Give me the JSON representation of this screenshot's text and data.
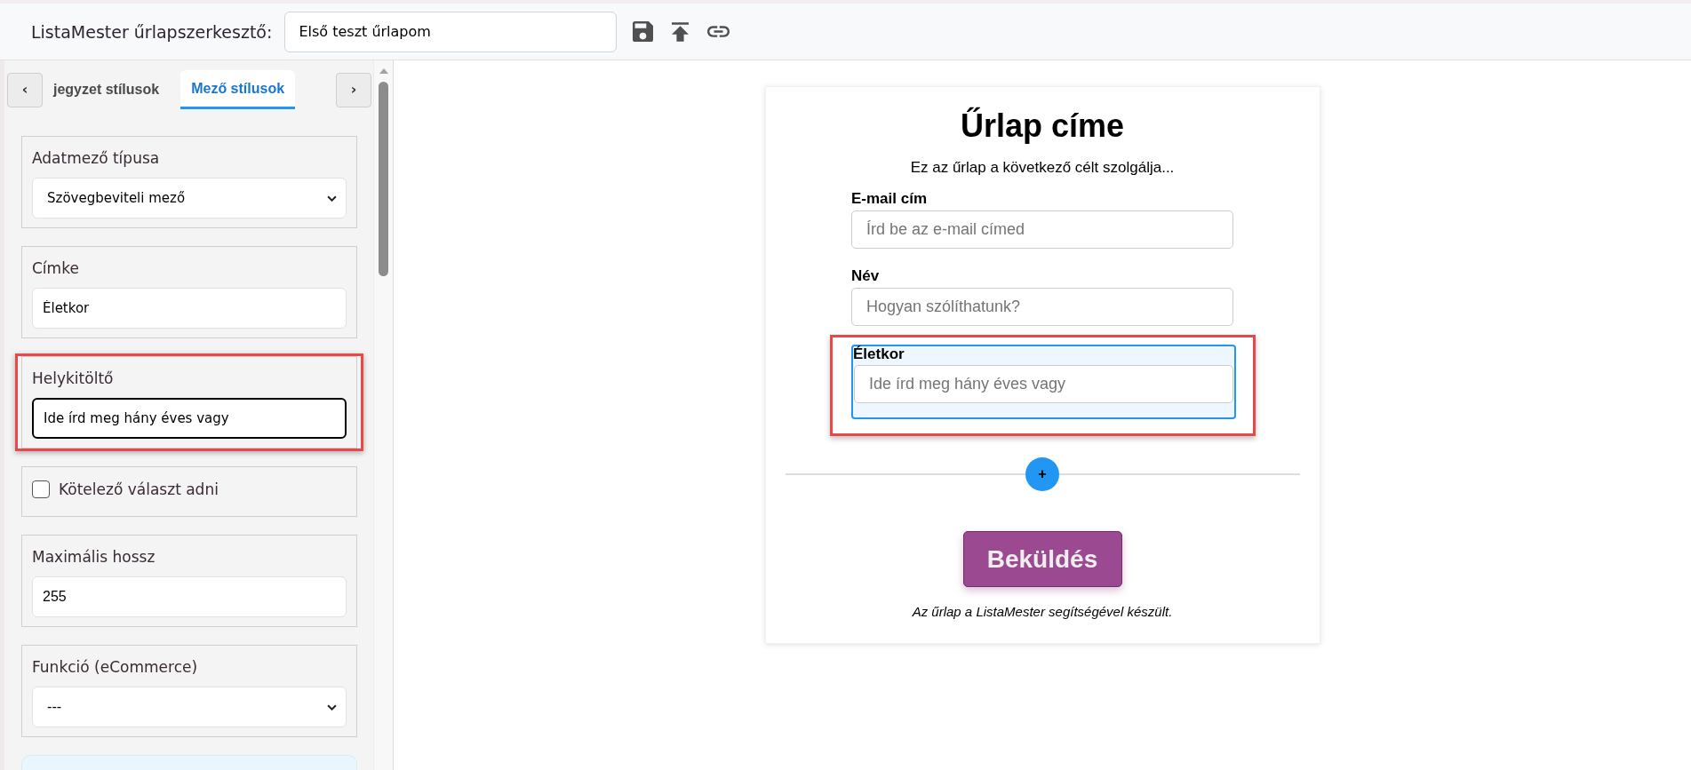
{
  "header": {
    "title": "ListaMester űrlapszerkesztő:",
    "form_name": "Első teszt űrlapom"
  },
  "sidebar": {
    "prev_button": "‹",
    "next_button": "›",
    "tabs": [
      {
        "label": "jegyzet stílusok",
        "selected": false
      },
      {
        "label": "Mező stílusok",
        "selected": true
      }
    ],
    "settings": [
      {
        "kind": "select",
        "label": "Adatmező típusa",
        "value": "Szövegbeviteli mező",
        "focused": false,
        "highlighted": false
      },
      {
        "kind": "text",
        "label": "Címke",
        "value": "Életkor",
        "focused": false,
        "highlighted": false
      },
      {
        "kind": "text",
        "label": "Helykitöltő",
        "value": "Ide írd meg hány éves vagy",
        "focused": true,
        "highlighted": true
      },
      {
        "kind": "checkbox",
        "label": "Kötelező választ adni",
        "checked": false,
        "focused": false,
        "highlighted": false
      },
      {
        "kind": "number",
        "label": "Maximális hossz",
        "value": "255",
        "focused": false,
        "highlighted": false
      },
      {
        "kind": "select",
        "label": "Funkció (eCommerce)",
        "value": "---",
        "focused": false,
        "highlighted": false
      }
    ]
  },
  "form": {
    "title": "Űrlap címe",
    "description": "Ez az űrlap a következő célt szolgálja...",
    "fields": [
      {
        "label": "E-mail cím",
        "placeholder": "Írd be az e-mail címed",
        "selected": false,
        "highlighted": false
      },
      {
        "label": "Név",
        "placeholder": "Hogyan szólíthatunk?",
        "selected": false,
        "highlighted": false
      },
      {
        "label": "Életkor",
        "placeholder": "Ide írd meg hány éves vagy",
        "selected": true,
        "highlighted": true
      }
    ],
    "add_button": "+",
    "submit_button": "Beküldés",
    "footer": "Az űrlap a ListaMester segítségével készült."
  }
}
